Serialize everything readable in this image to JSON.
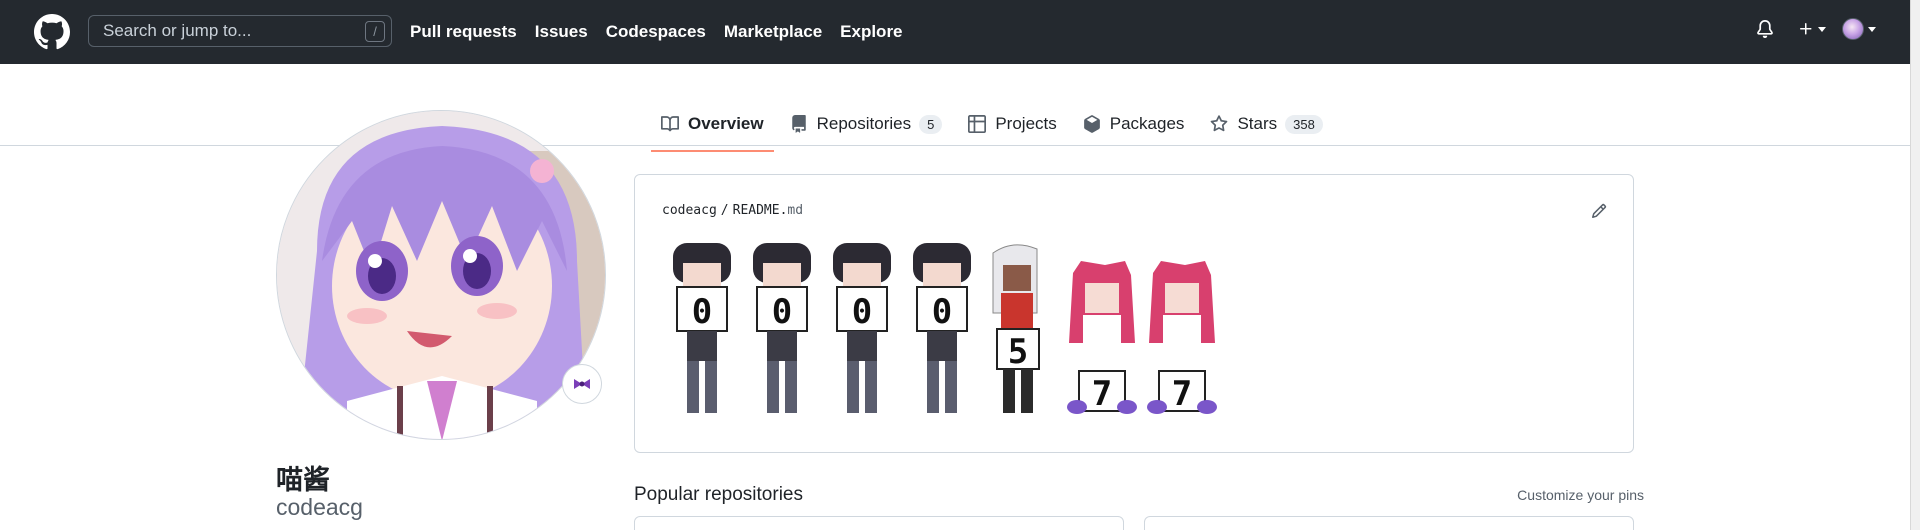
{
  "header": {
    "search": {
      "placeholder": "Search or jump to...",
      "shortcut": "/"
    },
    "nav": [
      "Pull requests",
      "Issues",
      "Codespaces",
      "Marketplace",
      "Explore"
    ],
    "icons": [
      "github-logo-icon",
      "bell-icon",
      "plus-icon",
      "avatar"
    ]
  },
  "tabs": [
    {
      "label": "Overview",
      "icon": "book-icon",
      "selected": true
    },
    {
      "label": "Repositories",
      "icon": "repo-icon",
      "count": "5"
    },
    {
      "label": "Projects",
      "icon": "table-icon"
    },
    {
      "label": "Packages",
      "icon": "package-icon"
    },
    {
      "label": "Stars",
      "icon": "star-icon",
      "count": "358"
    }
  ],
  "profile": {
    "name": "喵酱",
    "login": "codeacg",
    "status_emoji": "bow-icon"
  },
  "readme": {
    "owner": "codeacg",
    "separator": "/",
    "file_base": "README.",
    "file_ext": "md",
    "counter_digits": [
      "0",
      "0",
      "0",
      "0",
      "5",
      "7",
      "7"
    ]
  },
  "popular": {
    "title": "Popular repositories",
    "customize_label": "Customize your pins"
  },
  "colors": {
    "header_bg": "#24292f",
    "tab_underline": "#fd8c73",
    "border": "#d0d7de"
  }
}
